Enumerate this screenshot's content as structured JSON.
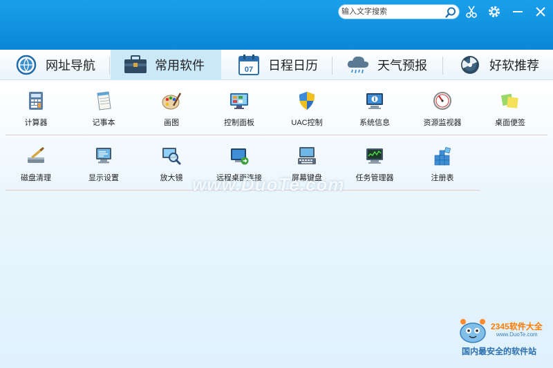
{
  "search": {
    "placeholder": "输入文字搜索",
    "value": ""
  },
  "tabs": [
    {
      "label": "网址导航",
      "icon": "globe-icon",
      "active": false
    },
    {
      "label": "常用软件",
      "icon": "toolbox-icon",
      "active": true
    },
    {
      "label": "日程日历",
      "icon": "calendar-icon",
      "active": false,
      "badge": "07"
    },
    {
      "label": "天气预报",
      "icon": "cloud-rain-icon",
      "active": false
    },
    {
      "label": "好软推荐",
      "icon": "disc-icon",
      "active": false
    }
  ],
  "software_rows": [
    [
      {
        "label": "计算器",
        "icon": "calculator-icon"
      },
      {
        "label": "记事本",
        "icon": "notepad-icon"
      },
      {
        "label": "画图",
        "icon": "paint-palette-icon"
      },
      {
        "label": "控制面板",
        "icon": "control-panel-icon"
      },
      {
        "label": "UAC控制",
        "icon": "uac-shield-icon"
      },
      {
        "label": "系统信息",
        "icon": "system-info-icon"
      },
      {
        "label": "资源监视器",
        "icon": "resource-monitor-icon"
      },
      {
        "label": "桌面便签",
        "icon": "sticky-notes-icon"
      }
    ],
    [
      {
        "label": "磁盘清理",
        "icon": "disk-cleanup-icon"
      },
      {
        "label": "显示设置",
        "icon": "display-settings-icon"
      },
      {
        "label": "放大镜",
        "icon": "magnifier-icon"
      },
      {
        "label": "远程桌面连接",
        "icon": "remote-desktop-icon"
      },
      {
        "label": "屏幕键盘",
        "icon": "onscreen-keyboard-icon"
      },
      {
        "label": "任务管理器",
        "icon": "task-manager-icon"
      },
      {
        "label": "注册表",
        "icon": "registry-icon"
      }
    ]
  ],
  "watermark": "www.DuoTe.com",
  "logo": {
    "brand": "2345软件大全",
    "url": "www.DuoTe.com",
    "slogan": "国内最安全的软件站"
  },
  "colors": {
    "titlebar": "#0b86d8",
    "active_tab": "#cbe8f8",
    "content_bg": "#dff1fc",
    "divider": "#e4c7cc"
  }
}
